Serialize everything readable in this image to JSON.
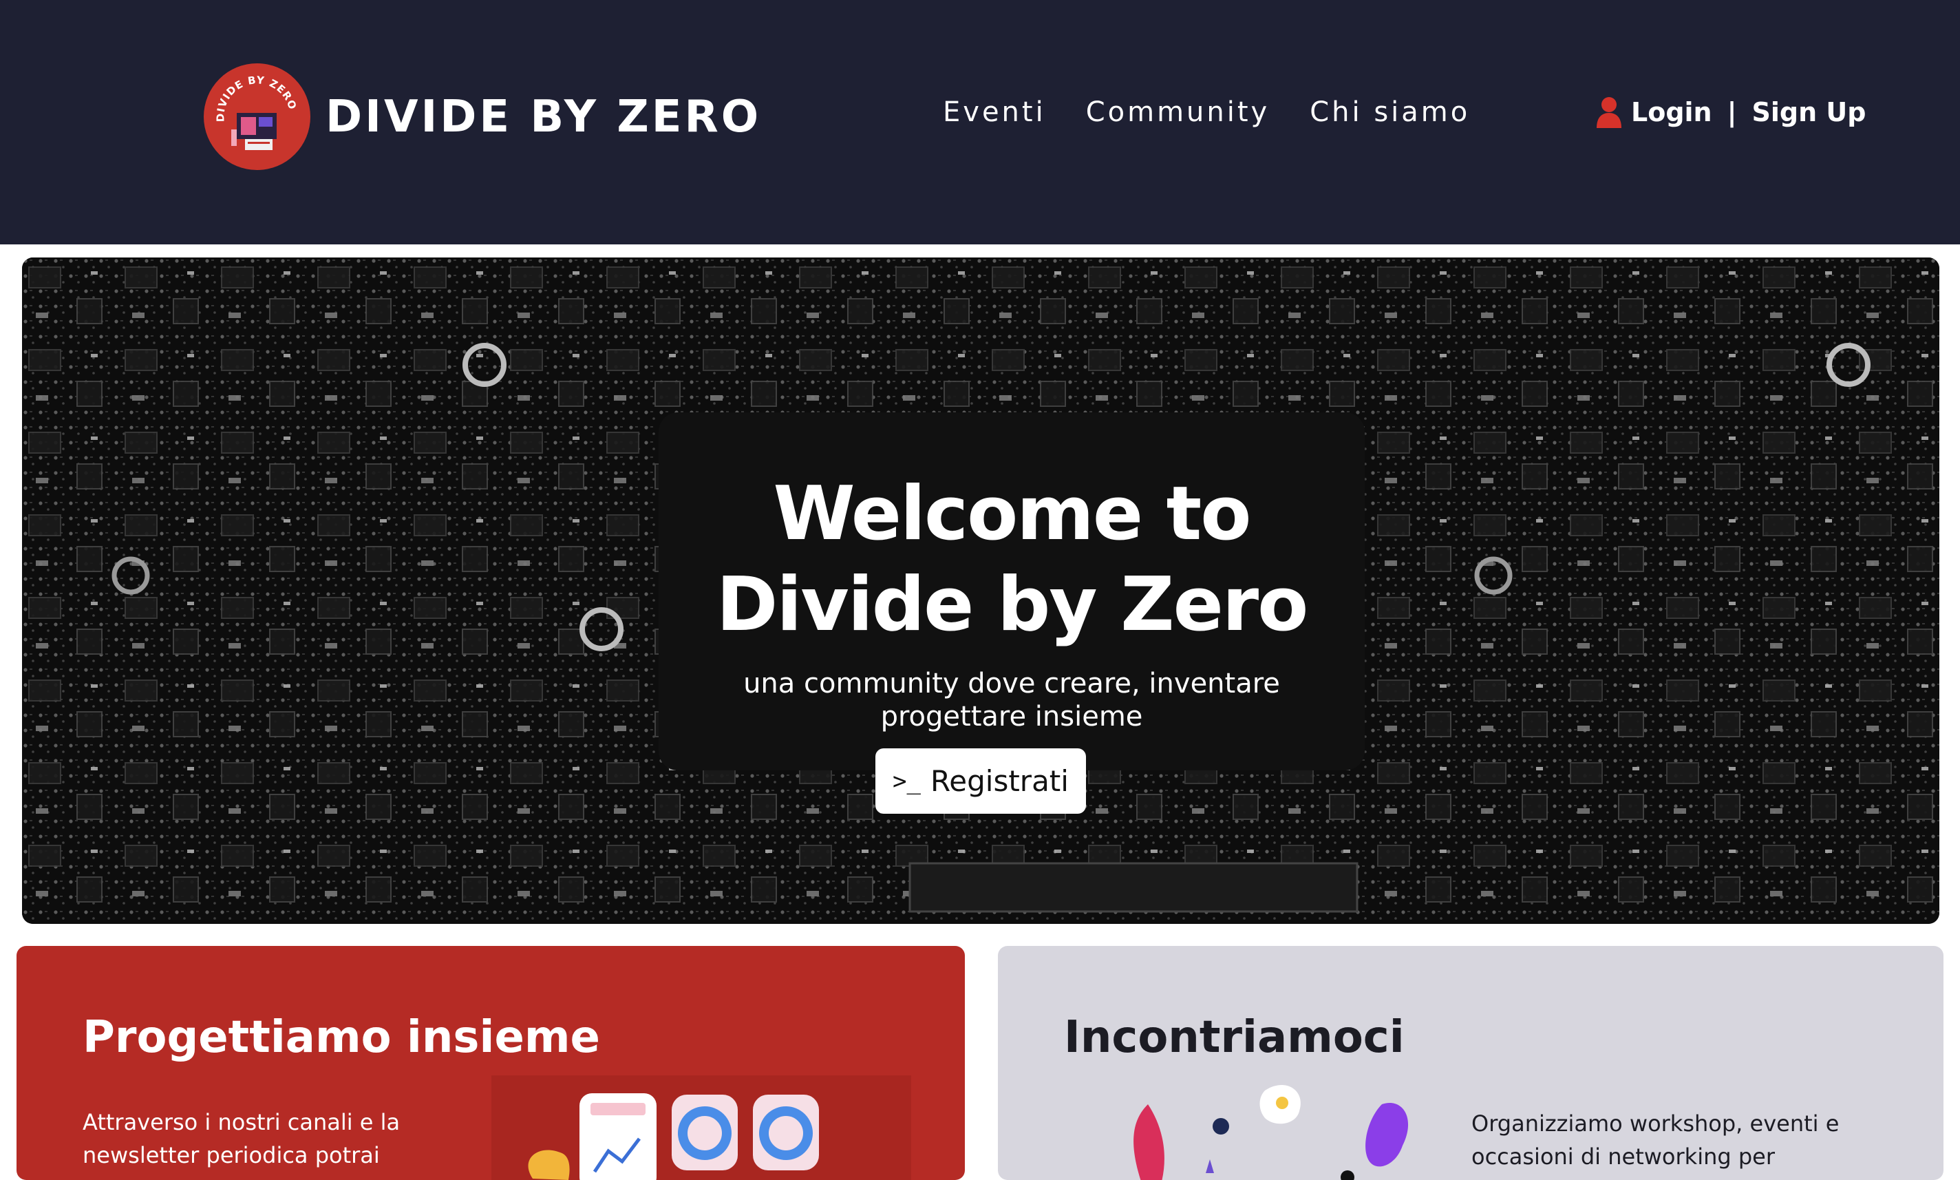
{
  "brand": {
    "name": "DIVIDE BY ZERO",
    "logo_text": "DIVIDE BY ZERO"
  },
  "nav": {
    "items": [
      {
        "label": "Eventi"
      },
      {
        "label": "Community"
      },
      {
        "label": "Chi siamo"
      }
    ]
  },
  "auth": {
    "login": "Login",
    "separator": "|",
    "signup": "Sign Up",
    "icon": "user-icon"
  },
  "hero": {
    "title_line1": "Welcome to",
    "title_line2": "Divide by Zero",
    "subtitle": "una community dove creare, inventare progettare insieme",
    "cta_icon": ">_",
    "cta_label": "Registrati"
  },
  "cards": [
    {
      "title": "Progettiamo insieme",
      "text": "Attraverso i nostri canali e la newsletter periodica potrai"
    },
    {
      "title": "Incontriamoci",
      "text": "Organizziamo workshop, eventi e occasioni di networking per"
    }
  ],
  "colors": {
    "navbar": "#1e2033",
    "accent_red": "#b52b25",
    "card_grey": "#d7d6de",
    "hero_card": "#111111"
  }
}
